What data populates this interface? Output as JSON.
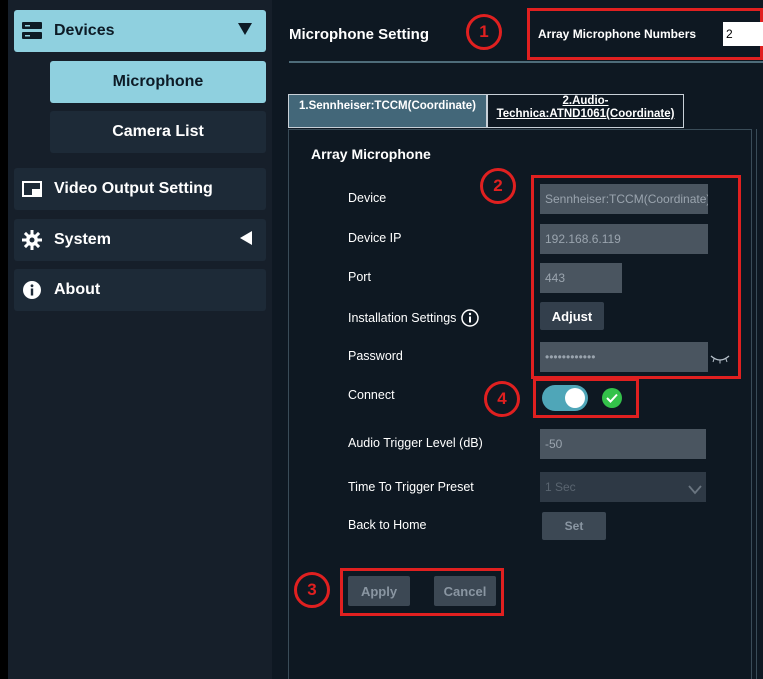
{
  "sidebar": {
    "devices_label": "Devices",
    "microphone_label": "Microphone",
    "camera_list_label": "Camera List",
    "video_output_label": "Video Output Setting",
    "system_label": "System",
    "about_label": "About"
  },
  "header": {
    "title": "Microphone Setting",
    "array_numbers_label": "Array Microphone Numbers",
    "array_numbers_value": "2"
  },
  "tabs": [
    {
      "label": "1.Sennheiser:TCCM(Coordinate)",
      "active": true
    },
    {
      "label_line1": "2.Audio-",
      "label_line2": "Technica:ATND1061(Coordinate)",
      "active": false
    }
  ],
  "form": {
    "section_title": "Array Microphone",
    "device_label": "Device",
    "device_value": "Sennheiser:TCCM(Coordinate)",
    "device_ip_label": "Device IP",
    "device_ip_value": "192.168.6.119",
    "port_label": "Port",
    "port_value": "443",
    "installation_label": "Installation Settings",
    "adjust_label": "Adjust",
    "password_label": "Password",
    "password_value": "••••••••••••",
    "connect_label": "Connect",
    "connect_on": true,
    "audio_trigger_label": "Audio Trigger Level (dB)",
    "audio_trigger_value": "-50",
    "time_trigger_label": "Time To Trigger Preset",
    "time_trigger_value": "1 Sec",
    "back_home_label": "Back to Home",
    "set_label": "Set",
    "apply_label": "Apply",
    "cancel_label": "Cancel"
  },
  "annotations": {
    "badge1": "1",
    "badge2": "2",
    "badge3": "3",
    "badge4": "4"
  },
  "colors": {
    "accent": "#8fd0df",
    "highlight_red": "#e02020",
    "toggle_on": "#4fa6b8",
    "status_ok": "#34c24a"
  }
}
